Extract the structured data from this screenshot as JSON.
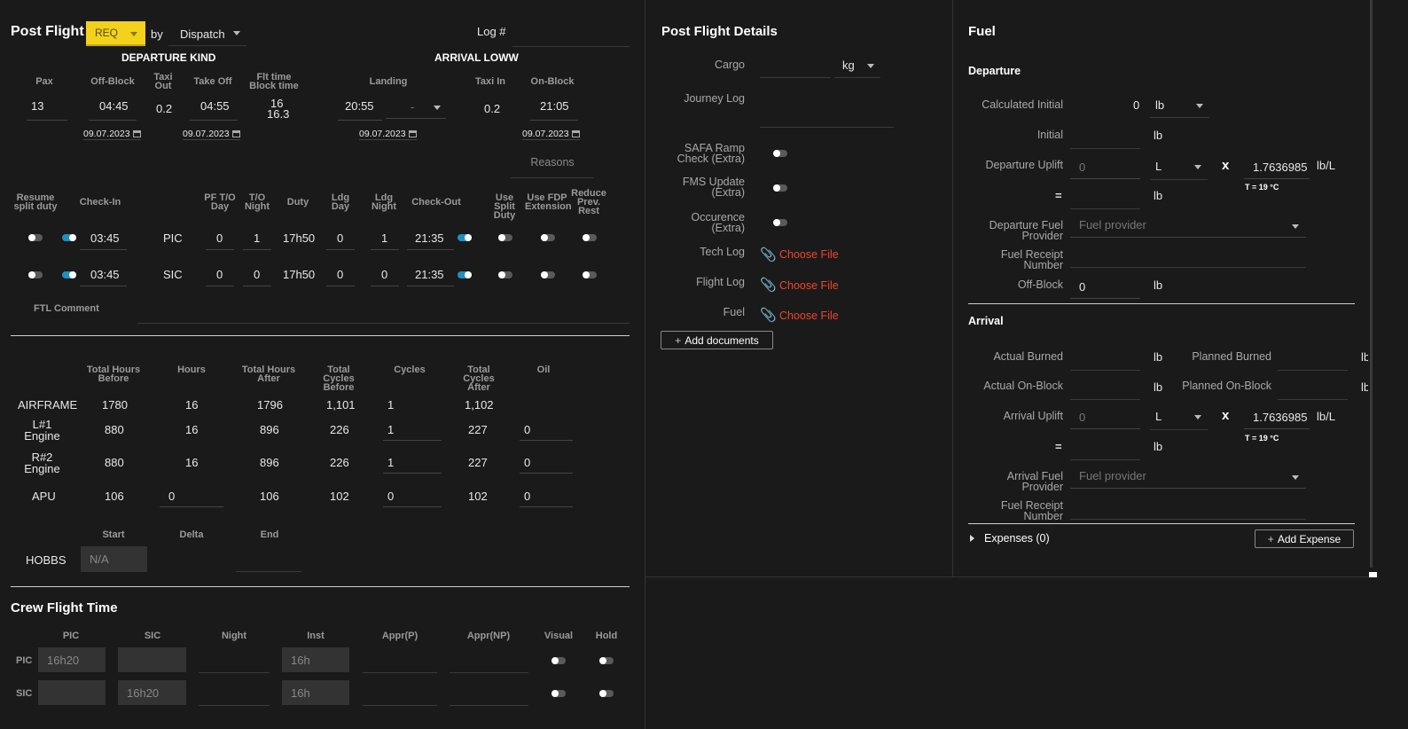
{
  "post_flight": {
    "title": "Post Flight",
    "status": "REQ",
    "by_label": "by",
    "by_value": "Dispatch",
    "log_label": "Log #",
    "departure_title": "DEPARTURE KIND",
    "arrival_title": "ARRIVAL LOWW",
    "headers": {
      "pax": "Pax",
      "off_block": "Off-Block",
      "taxi_out": "Taxi Out",
      "take_off": "Take Off",
      "flt_time": "Flt time",
      "block_time": "Block time",
      "landing": "Landing",
      "taxi_in": "Taxi In",
      "on_block": "On-Block"
    },
    "values": {
      "pax": "13",
      "off_block": "04:45",
      "taxi_out": "0.2",
      "take_off": "04:55",
      "flt_time": "16",
      "block_time": "16.3",
      "landing": "20:55",
      "landing_select": "-",
      "taxi_in": "0.2",
      "on_block": "21:05",
      "date_off_block": "09.07.2023",
      "date_take_off": "09.07.2023",
      "date_landing": "09.07.2023",
      "date_on_block": "09.07.2023"
    },
    "reasons_label": "Reasons"
  },
  "crew_duty": {
    "headers": {
      "resume": "Resume split duty",
      "check_in": "Check-In",
      "pf_day": "PF T/O Day",
      "to_night": "T/O Night",
      "duty": "Duty",
      "ldg_day": "Ldg Day",
      "ldg_night": "Ldg Night",
      "check_out": "Check-Out",
      "use_split": "Use Split Duty",
      "use_fdp": "Use FDP Extension",
      "reduce": "Reduce Prev. Rest"
    },
    "rows": [
      {
        "check_in": "03:45",
        "role": "PIC",
        "pf_day": "0",
        "to_night": "1",
        "duty": "17h50",
        "ldg_day": "0",
        "ldg_night": "1",
        "check_out": "21:35"
      },
      {
        "check_in": "03:45",
        "role": "SIC",
        "pf_day": "0",
        "to_night": "0",
        "duty": "17h50",
        "ldg_day": "0",
        "ldg_night": "0",
        "check_out": "21:35"
      }
    ],
    "ftl_comment_label": "FTL Comment"
  },
  "maintenance": {
    "headers": {
      "total_hours_before": "Total Hours Before",
      "hours": "Hours",
      "total_hours_after": "Total Hours After",
      "total_cycles_before": "Total Cycles Before",
      "cycles": "Cycles",
      "total_cycles_after": "Total Cycles After",
      "oil": "Oil"
    },
    "rows": [
      {
        "name": "AIRFRAME",
        "thb": "1780",
        "hours": "16",
        "tha": "1796",
        "tcb": "1,101",
        "cycles": "1",
        "tca": "1,102",
        "oil": ""
      },
      {
        "name": "L#1 Engine",
        "thb": "880",
        "hours": "16",
        "tha": "896",
        "tcb": "226",
        "cycles": "1",
        "tca": "227",
        "oil": "0"
      },
      {
        "name": "R#2 Engine",
        "thb": "880",
        "hours": "16",
        "tha": "896",
        "tcb": "226",
        "cycles": "1",
        "tca": "227",
        "oil": "0"
      },
      {
        "name": "APU",
        "thb": "106",
        "hours": "0",
        "tha": "106",
        "tcb": "102",
        "cycles": "0",
        "tca": "102",
        "oil": "0"
      }
    ],
    "hobbs": {
      "label": "HOBBS",
      "start_label": "Start",
      "delta_label": "Delta",
      "end_label": "End",
      "start_value": "N/A"
    }
  },
  "crew_flight_time": {
    "title": "Crew Flight Time",
    "headers": {
      "pic": "PIC",
      "sic": "SIC",
      "night": "Night",
      "inst": "Inst",
      "appr_p": "Appr(P)",
      "appr_np": "Appr(NP)",
      "visual": "Visual",
      "hold": "Hold"
    },
    "rows": [
      {
        "role": "PIC",
        "pic": "16h20",
        "sic": "",
        "inst": "16h"
      },
      {
        "role": "SIC",
        "pic": "",
        "sic": "16h20",
        "inst": "16h"
      }
    ]
  },
  "details": {
    "title": "Post Flight Details",
    "cargo_label": "Cargo",
    "cargo_unit": "kg",
    "journey_log_label": "Journey Log",
    "safa_label": "SAFA Ramp Check (Extra)",
    "fms_label": "FMS Update (Extra)",
    "occurence_label": "Occurence (Extra)",
    "tech_log_label": "Tech Log",
    "flight_log_label": "Flight Log",
    "fuel_label": "Fuel",
    "choose_file": "Choose File",
    "add_documents": "Add documents"
  },
  "fuel": {
    "title": "Fuel",
    "departure_title": "Departure",
    "calculated_initial_label": "Calculated Initial",
    "calculated_initial_value": "0",
    "calculated_initial_unit": "lb",
    "initial_label": "Initial",
    "initial_unit": "lb",
    "departure_uplift_label": "Departure Uplift",
    "uplift_placeholder": "0",
    "uplift_unit": "L",
    "multiply": "x",
    "density": "1.7636985",
    "density_unit": "lb/L",
    "temp": "T = 19 °C",
    "equals": "=",
    "equals_unit": "lb",
    "dep_provider_label": "Departure Fuel Provider",
    "provider_placeholder": "Fuel provider",
    "receipt_label": "Fuel Receipt Number",
    "off_block_label": "Off-Block",
    "off_block_value": "0",
    "off_block_unit": "lb",
    "arrival_title": "Arrival",
    "actual_burned_label": "Actual Burned",
    "planned_burned_label": "Planned Burned",
    "actual_onblock_label": "Actual On-Block",
    "planned_onblock_label": "Planned On-Block",
    "arrival_uplift_label": "Arrival Uplift",
    "arr_provider_label": "Arrival Fuel Provider",
    "expenses_label": "Expenses (0)",
    "add_expense": "Add Expense"
  },
  "colors": {
    "status_bg": "#f2d21b",
    "toggle_on": "#1e8fc0",
    "link": "#f0452a"
  }
}
